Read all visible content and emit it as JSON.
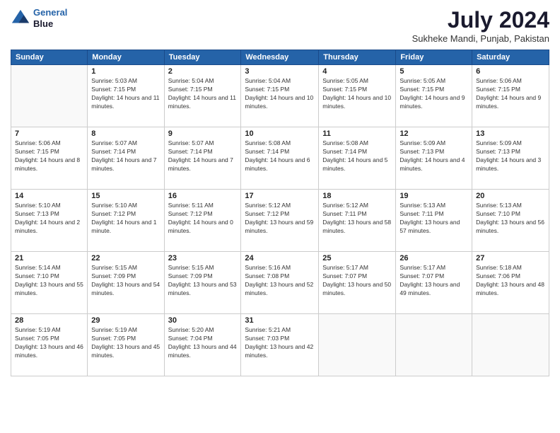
{
  "logo": {
    "line1": "General",
    "line2": "Blue"
  },
  "title": "July 2024",
  "subtitle": "Sukheke Mandi, Punjab, Pakistan",
  "headers": [
    "Sunday",
    "Monday",
    "Tuesday",
    "Wednesday",
    "Thursday",
    "Friday",
    "Saturday"
  ],
  "weeks": [
    [
      {
        "day": "",
        "sunrise": "",
        "sunset": "",
        "daylight": ""
      },
      {
        "day": "1",
        "sunrise": "Sunrise: 5:03 AM",
        "sunset": "Sunset: 7:15 PM",
        "daylight": "Daylight: 14 hours and 11 minutes."
      },
      {
        "day": "2",
        "sunrise": "Sunrise: 5:04 AM",
        "sunset": "Sunset: 7:15 PM",
        "daylight": "Daylight: 14 hours and 11 minutes."
      },
      {
        "day": "3",
        "sunrise": "Sunrise: 5:04 AM",
        "sunset": "Sunset: 7:15 PM",
        "daylight": "Daylight: 14 hours and 10 minutes."
      },
      {
        "day": "4",
        "sunrise": "Sunrise: 5:05 AM",
        "sunset": "Sunset: 7:15 PM",
        "daylight": "Daylight: 14 hours and 10 minutes."
      },
      {
        "day": "5",
        "sunrise": "Sunrise: 5:05 AM",
        "sunset": "Sunset: 7:15 PM",
        "daylight": "Daylight: 14 hours and 9 minutes."
      },
      {
        "day": "6",
        "sunrise": "Sunrise: 5:06 AM",
        "sunset": "Sunset: 7:15 PM",
        "daylight": "Daylight: 14 hours and 9 minutes."
      }
    ],
    [
      {
        "day": "7",
        "sunrise": "Sunrise: 5:06 AM",
        "sunset": "Sunset: 7:15 PM",
        "daylight": "Daylight: 14 hours and 8 minutes."
      },
      {
        "day": "8",
        "sunrise": "Sunrise: 5:07 AM",
        "sunset": "Sunset: 7:14 PM",
        "daylight": "Daylight: 14 hours and 7 minutes."
      },
      {
        "day": "9",
        "sunrise": "Sunrise: 5:07 AM",
        "sunset": "Sunset: 7:14 PM",
        "daylight": "Daylight: 14 hours and 7 minutes."
      },
      {
        "day": "10",
        "sunrise": "Sunrise: 5:08 AM",
        "sunset": "Sunset: 7:14 PM",
        "daylight": "Daylight: 14 hours and 6 minutes."
      },
      {
        "day": "11",
        "sunrise": "Sunrise: 5:08 AM",
        "sunset": "Sunset: 7:14 PM",
        "daylight": "Daylight: 14 hours and 5 minutes."
      },
      {
        "day": "12",
        "sunrise": "Sunrise: 5:09 AM",
        "sunset": "Sunset: 7:13 PM",
        "daylight": "Daylight: 14 hours and 4 minutes."
      },
      {
        "day": "13",
        "sunrise": "Sunrise: 5:09 AM",
        "sunset": "Sunset: 7:13 PM",
        "daylight": "Daylight: 14 hours and 3 minutes."
      }
    ],
    [
      {
        "day": "14",
        "sunrise": "Sunrise: 5:10 AM",
        "sunset": "Sunset: 7:13 PM",
        "daylight": "Daylight: 14 hours and 2 minutes."
      },
      {
        "day": "15",
        "sunrise": "Sunrise: 5:10 AM",
        "sunset": "Sunset: 7:12 PM",
        "daylight": "Daylight: 14 hours and 1 minute."
      },
      {
        "day": "16",
        "sunrise": "Sunrise: 5:11 AM",
        "sunset": "Sunset: 7:12 PM",
        "daylight": "Daylight: 14 hours and 0 minutes."
      },
      {
        "day": "17",
        "sunrise": "Sunrise: 5:12 AM",
        "sunset": "Sunset: 7:12 PM",
        "daylight": "Daylight: 13 hours and 59 minutes."
      },
      {
        "day": "18",
        "sunrise": "Sunrise: 5:12 AM",
        "sunset": "Sunset: 7:11 PM",
        "daylight": "Daylight: 13 hours and 58 minutes."
      },
      {
        "day": "19",
        "sunrise": "Sunrise: 5:13 AM",
        "sunset": "Sunset: 7:11 PM",
        "daylight": "Daylight: 13 hours and 57 minutes."
      },
      {
        "day": "20",
        "sunrise": "Sunrise: 5:13 AM",
        "sunset": "Sunset: 7:10 PM",
        "daylight": "Daylight: 13 hours and 56 minutes."
      }
    ],
    [
      {
        "day": "21",
        "sunrise": "Sunrise: 5:14 AM",
        "sunset": "Sunset: 7:10 PM",
        "daylight": "Daylight: 13 hours and 55 minutes."
      },
      {
        "day": "22",
        "sunrise": "Sunrise: 5:15 AM",
        "sunset": "Sunset: 7:09 PM",
        "daylight": "Daylight: 13 hours and 54 minutes."
      },
      {
        "day": "23",
        "sunrise": "Sunrise: 5:15 AM",
        "sunset": "Sunset: 7:09 PM",
        "daylight": "Daylight: 13 hours and 53 minutes."
      },
      {
        "day": "24",
        "sunrise": "Sunrise: 5:16 AM",
        "sunset": "Sunset: 7:08 PM",
        "daylight": "Daylight: 13 hours and 52 minutes."
      },
      {
        "day": "25",
        "sunrise": "Sunrise: 5:17 AM",
        "sunset": "Sunset: 7:07 PM",
        "daylight": "Daylight: 13 hours and 50 minutes."
      },
      {
        "day": "26",
        "sunrise": "Sunrise: 5:17 AM",
        "sunset": "Sunset: 7:07 PM",
        "daylight": "Daylight: 13 hours and 49 minutes."
      },
      {
        "day": "27",
        "sunrise": "Sunrise: 5:18 AM",
        "sunset": "Sunset: 7:06 PM",
        "daylight": "Daylight: 13 hours and 48 minutes."
      }
    ],
    [
      {
        "day": "28",
        "sunrise": "Sunrise: 5:19 AM",
        "sunset": "Sunset: 7:05 PM",
        "daylight": "Daylight: 13 hours and 46 minutes."
      },
      {
        "day": "29",
        "sunrise": "Sunrise: 5:19 AM",
        "sunset": "Sunset: 7:05 PM",
        "daylight": "Daylight: 13 hours and 45 minutes."
      },
      {
        "day": "30",
        "sunrise": "Sunrise: 5:20 AM",
        "sunset": "Sunset: 7:04 PM",
        "daylight": "Daylight: 13 hours and 44 minutes."
      },
      {
        "day": "31",
        "sunrise": "Sunrise: 5:21 AM",
        "sunset": "Sunset: 7:03 PM",
        "daylight": "Daylight: 13 hours and 42 minutes."
      },
      {
        "day": "",
        "sunrise": "",
        "sunset": "",
        "daylight": ""
      },
      {
        "day": "",
        "sunrise": "",
        "sunset": "",
        "daylight": ""
      },
      {
        "day": "",
        "sunrise": "",
        "sunset": "",
        "daylight": ""
      }
    ]
  ]
}
